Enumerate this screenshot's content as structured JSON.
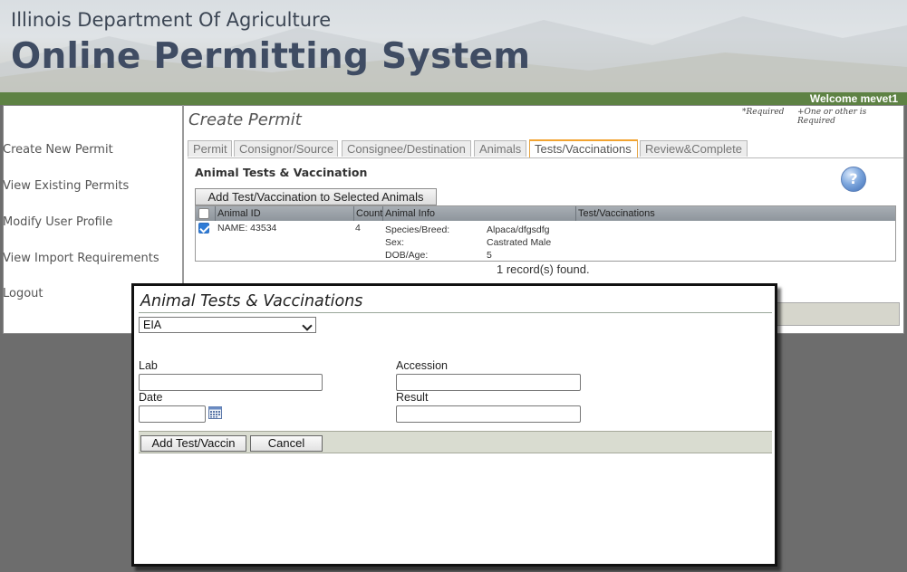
{
  "header": {
    "department": "Illinois Department Of Agriculture",
    "system": "Online Permitting System",
    "welcome": "Welcome mevet1"
  },
  "sidebar": {
    "items": [
      {
        "label": "Create New Permit"
      },
      {
        "label": "View Existing Permits"
      },
      {
        "label": "Modify User Profile"
      },
      {
        "label": "View Import Requirements"
      },
      {
        "label": "Logout"
      }
    ]
  },
  "main": {
    "title": "Create Permit",
    "required_note": "*Required",
    "either_note": "+One or other is Required",
    "tabs": [
      {
        "label": "Permit"
      },
      {
        "label": "Consignor/Source"
      },
      {
        "label": "Consignee/Destination"
      },
      {
        "label": "Animals"
      },
      {
        "label": "Tests/Vaccinations"
      },
      {
        "label": "Review&Complete"
      }
    ],
    "section_title": "Animal Tests & Vaccination",
    "help_icon_text": "?",
    "add_button": "Add Test/Vaccination to Selected Animals",
    "grid": {
      "headers": [
        "Animal ID",
        "Count",
        "Animal Info",
        "Test/Vaccinations"
      ],
      "row": {
        "checked": true,
        "animal_id": "NAME: 43534",
        "count": "4",
        "info_labels": [
          "Species/Breed:",
          "Sex:",
          "DOB/Age:"
        ],
        "info_values": [
          "Alpaca/dfgsdfg",
          "Castrated Male",
          "5"
        ]
      }
    },
    "records_found": "1 record(s) found."
  },
  "modal": {
    "title": "Animal Tests & Vaccinations",
    "test_select_value": "EIA",
    "lab_label": "Lab",
    "accession_label": "Accession",
    "date_label": "Date",
    "result_label": "Result",
    "add_button": "Add Test/Vaccin",
    "cancel_button": "Cancel"
  },
  "icons": {
    "help": "help-icon",
    "calendar": "calendar-icon",
    "checkbox": "checkbox"
  },
  "colors": {
    "green_bar": "#5e8244",
    "brand_text": "#3f4c63",
    "active_tab": "#f2a431"
  }
}
